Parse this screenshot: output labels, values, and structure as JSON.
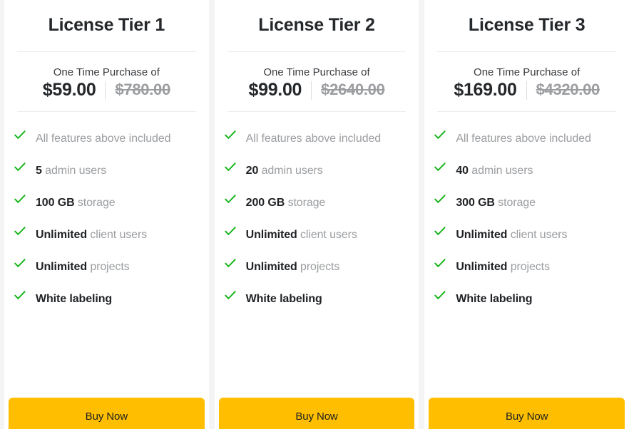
{
  "theme": {
    "page_background": "#f4f4f5",
    "card_background": "#ffffff",
    "accent_button": "#ffbf00",
    "check_green": "#12b215",
    "muted_text": "#9b9da0",
    "heading_text": "#25282b"
  },
  "tiers": [
    {
      "title": "License Tier 1",
      "price_caption": "One Time Purchase of",
      "price_current": "$59.00",
      "price_original": "$780.00",
      "features": [
        {
          "strong": "",
          "rest": "All features above included",
          "muted_all": true
        },
        {
          "strong": "5",
          "rest": " admin users",
          "muted_all": false
        },
        {
          "strong": "100 GB",
          "rest": " storage",
          "muted_all": false
        },
        {
          "strong": "Unlimited",
          "rest": " client users",
          "muted_all": false
        },
        {
          "strong": "Unlimited",
          "rest": " projects",
          "muted_all": false
        },
        {
          "strong": "White labeling",
          "rest": "",
          "muted_all": false
        }
      ],
      "buy_label": "Buy Now"
    },
    {
      "title": "License Tier 2",
      "price_caption": "One Time Purchase of",
      "price_current": "$99.00",
      "price_original": "$2640.00",
      "features": [
        {
          "strong": "",
          "rest": "All features above included",
          "muted_all": true
        },
        {
          "strong": "20",
          "rest": " admin users",
          "muted_all": false
        },
        {
          "strong": "200 GB",
          "rest": " storage",
          "muted_all": false
        },
        {
          "strong": "Unlimited",
          "rest": " client users",
          "muted_all": false
        },
        {
          "strong": "Unlimited",
          "rest": " projects",
          "muted_all": false
        },
        {
          "strong": "White labeling",
          "rest": "",
          "muted_all": false
        }
      ],
      "buy_label": "Buy Now"
    },
    {
      "title": "License Tier 3",
      "price_caption": "One Time Purchase of",
      "price_current": "$169.00",
      "price_original": "$4320.00",
      "features": [
        {
          "strong": "",
          "rest": "All features above included",
          "muted_all": true
        },
        {
          "strong": "40",
          "rest": " admin users",
          "muted_all": false
        },
        {
          "strong": "300 GB",
          "rest": " storage",
          "muted_all": false
        },
        {
          "strong": "Unlimited",
          "rest": " client users",
          "muted_all": false
        },
        {
          "strong": "Unlimited",
          "rest": " projects",
          "muted_all": false
        },
        {
          "strong": "White labeling",
          "rest": "",
          "muted_all": false
        }
      ],
      "buy_label": "Buy Now"
    }
  ],
  "icons": {
    "check": "check-icon"
  }
}
